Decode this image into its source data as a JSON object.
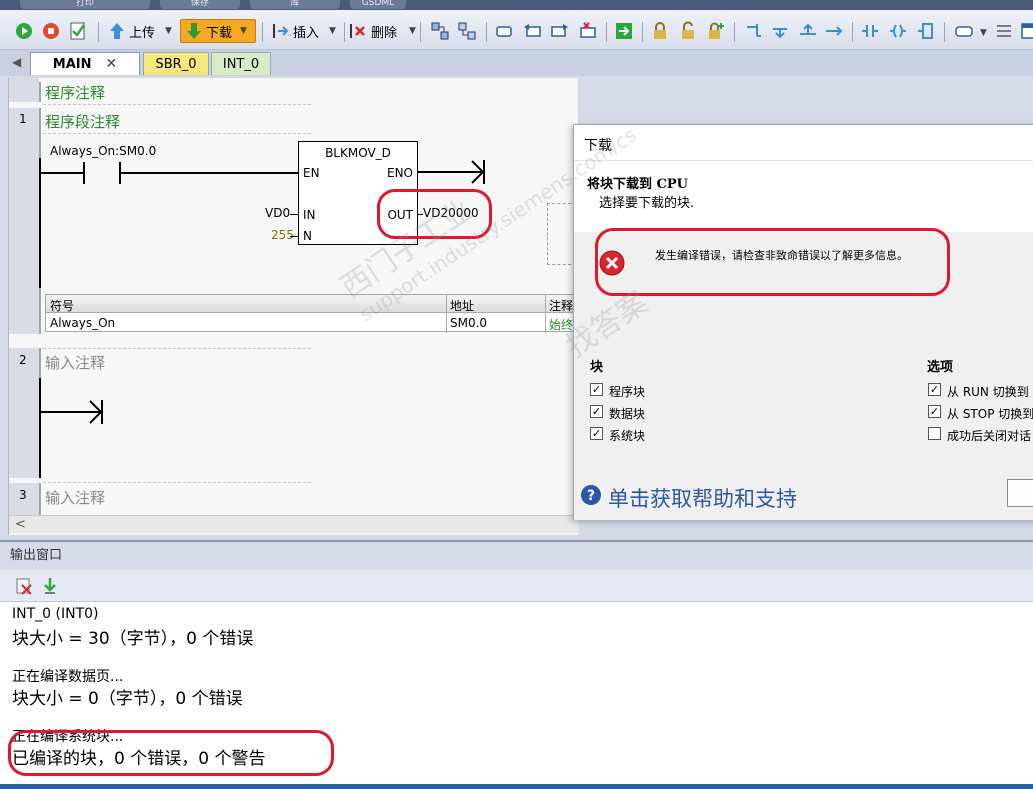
{
  "top_tabs": [
    "打印",
    "保存",
    "库",
    "GSDML"
  ],
  "toolbar": {
    "upload_label": "上传",
    "download_label": "下载",
    "insert_label": "插入",
    "delete_label": "删除"
  },
  "editor_tabs": [
    {
      "label": "MAIN",
      "active": true
    },
    {
      "label": "SBR_0",
      "active": false
    },
    {
      "label": "INT_0",
      "active": false
    }
  ],
  "editor": {
    "program_comment": "程序注释",
    "networks": [
      {
        "number": "1",
        "comment": "程序段注释",
        "contact_label": "Always_On:SM0.0",
        "box": {
          "name": "BLKMOV_D",
          "en": "EN",
          "eno": "ENO",
          "in": "IN",
          "n": "N",
          "out": "OUT",
          "in_value": "VD0",
          "n_value": "255",
          "out_value": "VD20000"
        },
        "symbol_table": {
          "headers": [
            "符号",
            "地址",
            "注释"
          ],
          "rows": [
            [
              "Always_On",
              "SM0.0",
              "始终"
            ]
          ]
        }
      },
      {
        "number": "2",
        "comment": "输入注释"
      },
      {
        "number": "3",
        "comment": "输入注释"
      }
    ]
  },
  "dialog": {
    "title": "下载",
    "heading": "将块下载到 CPU",
    "subheading": "选择要下载的块.",
    "error_message": "发生编译错误，请检查非致命错误以了解更多信息。",
    "blocks_title": "块",
    "blocks": [
      {
        "label": "程序块",
        "checked": true
      },
      {
        "label": "数据块",
        "checked": true
      },
      {
        "label": "系统块",
        "checked": true
      }
    ],
    "options_title": "选项",
    "options": [
      {
        "label": "从 RUN 切换到",
        "checked": true
      },
      {
        "label": "从 STOP 切换到",
        "checked": true
      },
      {
        "label": "成功后关闭对话",
        "checked": false
      }
    ],
    "help_link": "单击获取帮助和支持"
  },
  "output": {
    "title": "输出窗口",
    "lines": [
      "INT_0 (INT0)",
      "块大小 = 30（字节），0 个错误",
      "",
      "正在编译数据页...",
      "块大小 = 0（字节），0 个错误",
      "",
      "正在编译系统块...",
      "已编译的块，0 个错误，0 个警告"
    ]
  },
  "watermark": [
    "西门子工业",
    "support.industry.siemens.com/cs",
    "找答案"
  ],
  "colors": {
    "comment_green": "#2b8a2b",
    "highlight_red": "#e0182d",
    "download_orange": "#f7a823",
    "error_red": "#d9262e",
    "help_blue": "#2a57a8"
  }
}
